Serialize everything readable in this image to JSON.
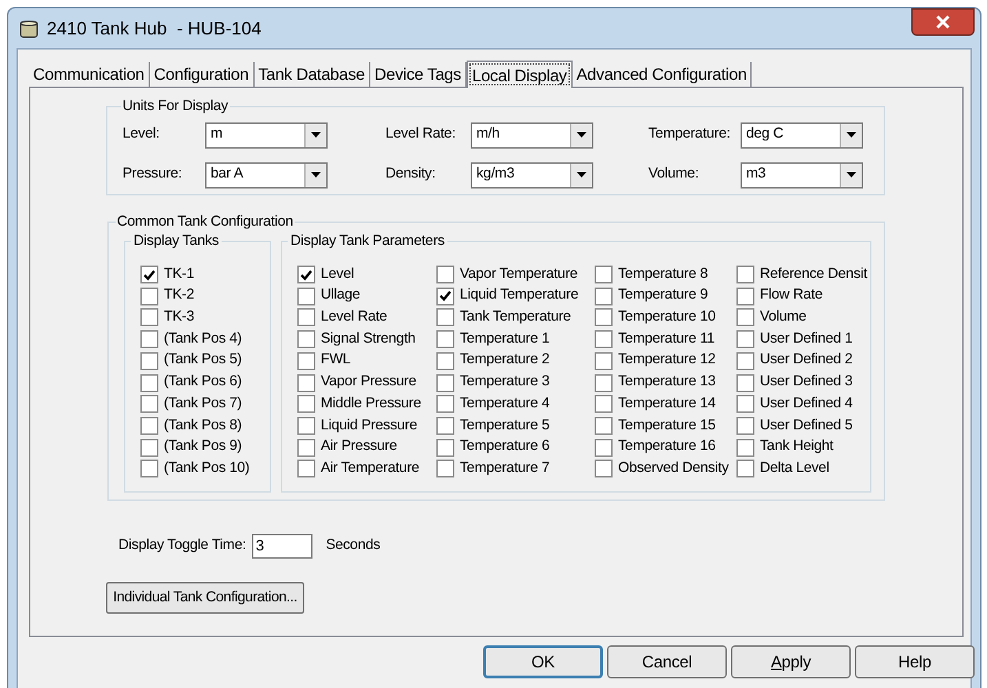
{
  "window": {
    "title": "2410 Tank Hub  - HUB-104"
  },
  "tabs": [
    {
      "label": "Communication",
      "selected": false
    },
    {
      "label": "Configuration",
      "selected": false
    },
    {
      "label": "Tank Database",
      "selected": false
    },
    {
      "label": "Device Tags",
      "selected": false
    },
    {
      "label": "Local Display",
      "selected": true
    },
    {
      "label": "Advanced Configuration",
      "selected": false
    }
  ],
  "units": {
    "title": "Units For Display",
    "fields": [
      {
        "label": "Level:",
        "value": "m"
      },
      {
        "label": "Level Rate:",
        "value": "m/h"
      },
      {
        "label": "Temperature:",
        "value": "deg C"
      },
      {
        "label": "Pressure:",
        "value": "bar A"
      },
      {
        "label": "Density:",
        "value": "kg/m3"
      },
      {
        "label": "Volume:",
        "value": "m3"
      }
    ]
  },
  "common": {
    "title": "Common Tank Configuration",
    "display_tanks": {
      "title": "Display Tanks",
      "items": [
        {
          "label": "TK-1",
          "checked": true
        },
        {
          "label": "TK-2",
          "checked": false
        },
        {
          "label": "TK-3",
          "checked": false
        },
        {
          "label": "(Tank Pos 4)",
          "checked": false
        },
        {
          "label": "(Tank Pos 5)",
          "checked": false
        },
        {
          "label": "(Tank Pos 6)",
          "checked": false
        },
        {
          "label": "(Tank Pos 7)",
          "checked": false
        },
        {
          "label": "(Tank Pos 8)",
          "checked": false
        },
        {
          "label": "(Tank Pos 9)",
          "checked": false
        },
        {
          "label": "(Tank Pos 10)",
          "checked": false
        }
      ]
    },
    "parameters": {
      "title": "Display Tank Parameters",
      "columns": [
        [
          {
            "label": "Level",
            "checked": true
          },
          {
            "label": "Ullage",
            "checked": false
          },
          {
            "label": "Level Rate",
            "checked": false
          },
          {
            "label": "Signal Strength",
            "checked": false
          },
          {
            "label": "FWL",
            "checked": false
          },
          {
            "label": "Vapor Pressure",
            "checked": false
          },
          {
            "label": "Middle Pressure",
            "checked": false
          },
          {
            "label": "Liquid Pressure",
            "checked": false
          },
          {
            "label": "Air Pressure",
            "checked": false
          },
          {
            "label": "Air Temperature",
            "checked": false
          }
        ],
        [
          {
            "label": "Vapor Temperature",
            "checked": false
          },
          {
            "label": "Liquid Temperature",
            "checked": true
          },
          {
            "label": "Tank Temperature",
            "checked": false
          },
          {
            "label": "Temperature 1",
            "checked": false
          },
          {
            "label": "Temperature 2",
            "checked": false
          },
          {
            "label": "Temperature 3",
            "checked": false
          },
          {
            "label": "Temperature 4",
            "checked": false
          },
          {
            "label": "Temperature 5",
            "checked": false
          },
          {
            "label": "Temperature 6",
            "checked": false
          },
          {
            "label": "Temperature 7",
            "checked": false
          }
        ],
        [
          {
            "label": "Temperature 8",
            "checked": false
          },
          {
            "label": "Temperature 9",
            "checked": false
          },
          {
            "label": "Temperature 10",
            "checked": false
          },
          {
            "label": "Temperature 11",
            "checked": false
          },
          {
            "label": "Temperature 12",
            "checked": false
          },
          {
            "label": "Temperature 13",
            "checked": false
          },
          {
            "label": "Temperature 14",
            "checked": false
          },
          {
            "label": "Temperature 15",
            "checked": false
          },
          {
            "label": "Temperature 16",
            "checked": false
          },
          {
            "label": "Observed Density",
            "checked": false
          }
        ],
        [
          {
            "label": "Reference Densit",
            "checked": false
          },
          {
            "label": "Flow Rate",
            "checked": false
          },
          {
            "label": "Volume",
            "checked": false
          },
          {
            "label": "User Defined 1",
            "checked": false
          },
          {
            "label": "User Defined 2",
            "checked": false
          },
          {
            "label": "User Defined 3",
            "checked": false
          },
          {
            "label": "User Defined 4",
            "checked": false
          },
          {
            "label": "User Defined 5",
            "checked": false
          },
          {
            "label": "Tank Height",
            "checked": false
          },
          {
            "label": "Delta Level",
            "checked": false
          }
        ]
      ]
    }
  },
  "toggle": {
    "label": "Display Toggle Time:",
    "value": "3",
    "unit": "Seconds"
  },
  "individual_button": "Individual Tank Configuration...",
  "buttons": [
    {
      "label": "OK",
      "default": true
    },
    {
      "label": "Cancel",
      "default": false
    },
    {
      "label": "Apply",
      "default": false,
      "first_letter_underlined": true
    },
    {
      "label": "Help",
      "default": false
    }
  ]
}
